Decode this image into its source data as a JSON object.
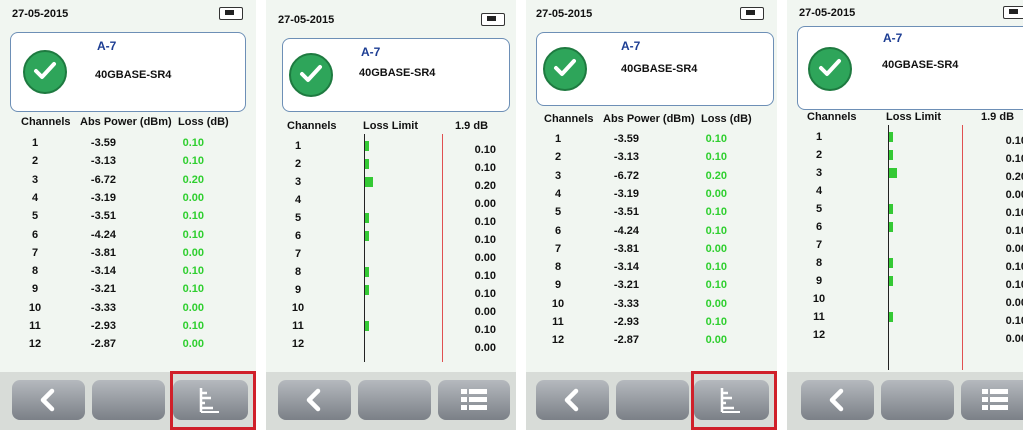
{
  "header": {
    "date": "27-05-2015"
  },
  "result": {
    "name": "A-7",
    "standard": "40GBASE-SR4"
  },
  "table": {
    "headers": {
      "channels": "Channels",
      "abs_power": "Abs Power (dBm)",
      "loss": "Loss (dB)"
    },
    "rows": [
      {
        "ch": "1",
        "power": "-3.59",
        "loss": "0.10"
      },
      {
        "ch": "2",
        "power": "-3.13",
        "loss": "0.10"
      },
      {
        "ch": "3",
        "power": "-6.72",
        "loss": "0.20"
      },
      {
        "ch": "4",
        "power": "-3.19",
        "loss": "0.00"
      },
      {
        "ch": "5",
        "power": "-3.51",
        "loss": "0.10"
      },
      {
        "ch": "6",
        "power": "-4.24",
        "loss": "0.10"
      },
      {
        "ch": "7",
        "power": "-3.81",
        "loss": "0.00"
      },
      {
        "ch": "8",
        "power": "-3.14",
        "loss": "0.10"
      },
      {
        "ch": "9",
        "power": "-3.21",
        "loss": "0.10"
      },
      {
        "ch": "10",
        "power": "-3.33",
        "loss": "0.00"
      },
      {
        "ch": "11",
        "power": "-2.93",
        "loss": "0.10"
      },
      {
        "ch": "12",
        "power": "-2.87",
        "loss": "0.00"
      }
    ]
  },
  "graph": {
    "headers": {
      "channels": "Channels",
      "loss_limit": "Loss Limit",
      "limit_value": "1.9 dB"
    },
    "limit_db": 1.9,
    "values": [
      0.1,
      0.1,
      0.2,
      0.0,
      0.1,
      0.1,
      0.0,
      0.1,
      0.1,
      0.0,
      0.1,
      0.0
    ]
  },
  "icons": {
    "back": "chevron-left-icon",
    "view_graph": "bar-graph-icon",
    "view_table": "list-icon"
  },
  "colors": {
    "pass": "#2ea55a",
    "loss_value": "#2fcf2f",
    "limit_line": "#e05050",
    "highlight": "#d0202a"
  }
}
